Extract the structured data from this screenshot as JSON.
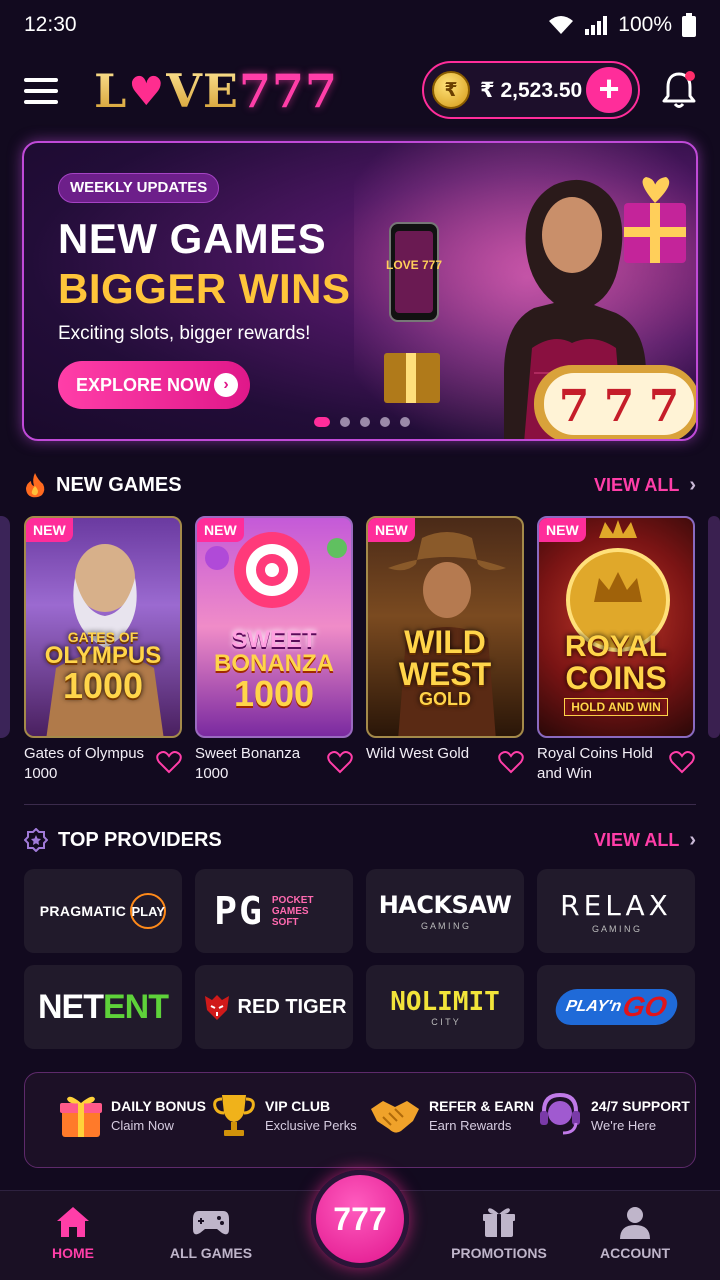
{
  "status_bar": {
    "time": "12:30",
    "battery": "100%",
    "icons": [
      "wifi-icon",
      "signal-icon",
      "battery-icon"
    ]
  },
  "header": {
    "logo_prefix": "L",
    "logo_heart": "♥",
    "logo_suffix": "VE",
    "logo_number": "777",
    "balance": "₹ 2,523.50",
    "coin_symbol": "₹",
    "add_label": "+"
  },
  "banner": {
    "tag": "WEEKLY UPDATES",
    "title_line1": "NEW GAMES",
    "title_line2": "BIGGER WINS",
    "subtitle": "Exciting slots, bigger rewards!",
    "cta": "EXPLORE NOW",
    "phone_logo": "LOVE 777",
    "reel_digits": [
      "7",
      "7",
      "7"
    ],
    "slide_count": 5,
    "active_slide": 1
  },
  "new_games": {
    "title": "NEW GAMES",
    "view_all": "VIEW ALL",
    "badge": "NEW",
    "items": [
      {
        "name": "Gates of Olympus 1000",
        "art_line1": "GATES OF",
        "art_line2": "OLYMPUS",
        "art_line3": "1000"
      },
      {
        "name": "Sweet Bonanza 1000",
        "art_line1": "SWEET",
        "art_line2": "BONANZA",
        "art_line3": "1000"
      },
      {
        "name": "Wild West Gold",
        "art_line1": "WILD",
        "art_line2": "WEST",
        "art_line3": "GOLD"
      },
      {
        "name": "Royal Coins Hold and Win",
        "art_line1": "ROYAL",
        "art_line2": "COINS",
        "art_line3": "HOLD AND WIN"
      }
    ]
  },
  "top_providers": {
    "title": "TOP PROVIDERS",
    "view_all": "VIEW ALL",
    "items": [
      {
        "name": "PRAGMATIC",
        "sub": "PLAY"
      },
      {
        "name": "PG",
        "sub": "POCKET GAMES SOFT"
      },
      {
        "name": "HACKSAW",
        "sub": "G A M I N G"
      },
      {
        "name": "RELAX",
        "sub": "G A M I N G"
      },
      {
        "name": "NET",
        "sub": "ENT"
      },
      {
        "name": "RED TIGER",
        "sub": ""
      },
      {
        "name": "NOLIMIT",
        "sub": "C I T Y"
      },
      {
        "name": "PLAY'n",
        "sub": "GO"
      }
    ]
  },
  "features": [
    {
      "title": "DAILY BONUS",
      "sub": "Claim Now",
      "icon": "gift-icon"
    },
    {
      "title": "VIP CLUB",
      "sub": "Exclusive Perks",
      "icon": "trophy-icon"
    },
    {
      "title": "REFER & EARN",
      "sub": "Earn Rewards",
      "icon": "handshake-icon"
    },
    {
      "title": "24/7 SUPPORT",
      "sub": "We're Here",
      "icon": "headset-icon"
    }
  ],
  "bottom_nav": {
    "home": "HOME",
    "all_games": "ALL GAMES",
    "center": "777",
    "promotions": "PROMOTIONS",
    "account": "ACCOUNT",
    "active": "home"
  },
  "colors": {
    "accent": "#ff2d9a",
    "gold": "#ffc53a",
    "background": "#120a1f"
  }
}
